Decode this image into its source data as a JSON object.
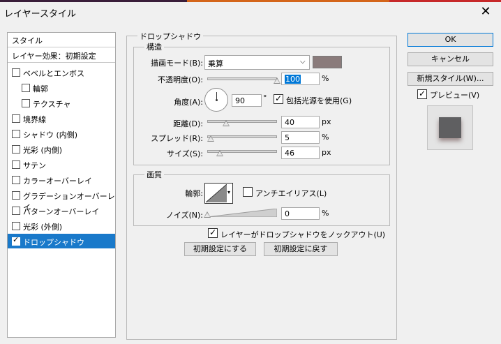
{
  "dialog": {
    "title": "レイヤースタイル"
  },
  "sidebar": {
    "header": "スタイル",
    "subheader": "レイヤー効果：初期設定",
    "items": [
      {
        "label": "ベベルとエンボス",
        "checked": false
      },
      {
        "label": "輪郭",
        "checked": false
      },
      {
        "label": "テクスチャ",
        "checked": false
      },
      {
        "label": "境界線",
        "checked": false
      },
      {
        "label": "シャドウ (内側)",
        "checked": false
      },
      {
        "label": "光彩 (内側)",
        "checked": false
      },
      {
        "label": "サテン",
        "checked": false
      },
      {
        "label": "カラーオーバーレイ",
        "checked": false
      },
      {
        "label": "グラデーションオーバーレイ",
        "checked": false
      },
      {
        "label": "パターンオーバーレイ",
        "checked": false
      },
      {
        "label": "光彩 (外側)",
        "checked": false
      },
      {
        "label": "ドロップシャドウ",
        "checked": true,
        "selected": true
      }
    ]
  },
  "drop_shadow": {
    "title": "ドロップシャドウ",
    "structure": {
      "title": "構造",
      "blend_mode_label": "描画モード(B):",
      "blend_mode_value": "乗算",
      "shadow_color": "#8a7b7b",
      "opacity_label": "不透明度(O):",
      "opacity_value": "100",
      "opacity_unit": "%",
      "opacity_level": 1.0,
      "angle_label": "角度(A):",
      "angle_value": "90",
      "angle_unit": "°",
      "global_light_label": "包括光源を使用(G)",
      "global_light_checked": true,
      "distance_label": "距離(D):",
      "distance_value": "40",
      "distance_unit": "px",
      "distance_level": 0.27,
      "spread_label": "スプレッド(R):",
      "spread_value": "5",
      "spread_unit": "%",
      "spread_level": 0.05,
      "size_label": "サイズ(S):",
      "size_value": "46",
      "size_unit": "px",
      "size_level": 0.18
    },
    "quality": {
      "title": "画質",
      "contour_label": "輪郭:",
      "antialias_label": "アンチエイリアス(L)",
      "antialias_checked": false,
      "noise_label": "ノイズ(N):",
      "noise_value": "0",
      "noise_unit": "%",
      "noise_level": 0.0
    },
    "knockout_label": "レイヤーがドロップシャドウをノックアウト(U)",
    "knockout_checked": true,
    "make_default_label": "初期設定にする",
    "reset_default_label": "初期設定に戻す"
  },
  "buttons": {
    "ok": "OK",
    "cancel": "キャンセル",
    "new_style": "新規スタイル(W)...",
    "preview_label": "プレビュー(V)",
    "preview_checked": true
  },
  "colors": {
    "selection": "#1979ca",
    "preview_swatch": "#5f5f61",
    "ok_border": "#0078d7"
  }
}
